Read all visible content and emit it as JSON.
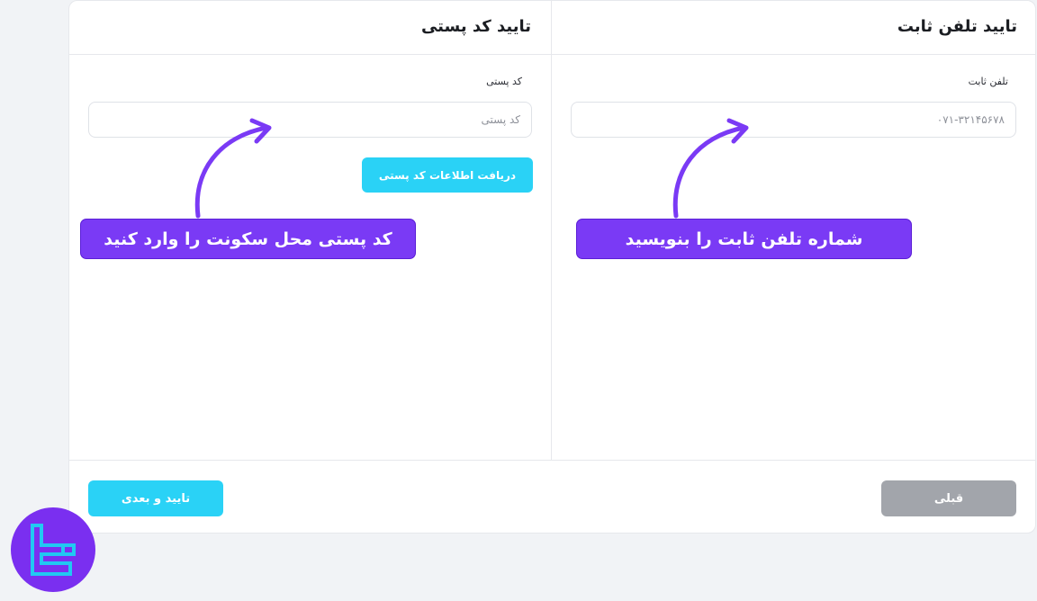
{
  "colors": {
    "accent_cyan": "#2ad2f6",
    "callout_purple": "#7a3af5",
    "prev_gray": "#a2a5ab",
    "logo_purple": "#7a2ff0",
    "logo_cyan": "#21c9f2"
  },
  "phone_section": {
    "title": "تایید تلفن ثابت",
    "label": "تلفن ثابت",
    "placeholder": "۰۷۱-۳۲۱۴۵۶۷۸"
  },
  "postal_section": {
    "title": "تایید کد پستی",
    "label": "کد پستی",
    "placeholder": "کد پستی",
    "fetch_button": "دریافت اطلاعات کد پستی"
  },
  "callouts": {
    "phone": "شماره تلفن ثابت را بنویسید",
    "postal": "کد پستی محل سکونت را وارد کنید"
  },
  "footer": {
    "prev_label": "قبلی",
    "next_label": "تایید و بعدی"
  },
  "icons": {
    "arrow": "curved-arrow-icon",
    "logo": "brand-logo-icon"
  }
}
